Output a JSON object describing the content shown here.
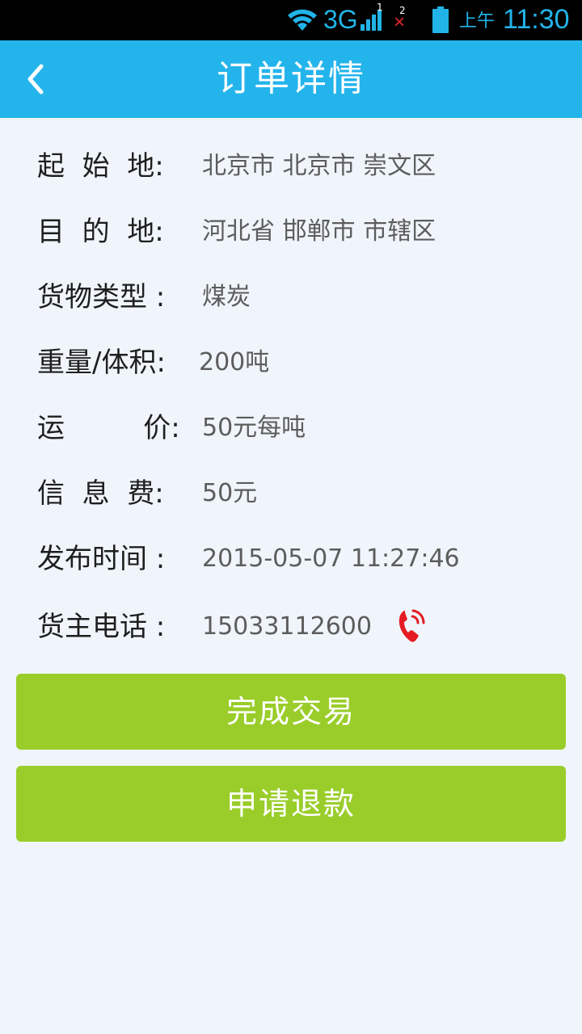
{
  "status_bar": {
    "network": "3G",
    "sim1": "1",
    "sim2": "2",
    "ampm": "上午",
    "time": "11:30",
    "accent_color": "#22b4e8",
    "nosim_color": "#e8262a"
  },
  "header": {
    "title": "订单详情",
    "back_icon": "chevron-left-icon",
    "background": "#24b4ec"
  },
  "details": [
    {
      "label": "起  始  地:",
      "value": "北京市 北京市 崇文区"
    },
    {
      "label": "目  的  地:",
      "value": "河北省 邯郸市 市辖区"
    },
    {
      "label": "货物类型 :",
      "value": "煤炭"
    },
    {
      "label": "重量/体积:",
      "value": "200吨"
    },
    {
      "label": "运         价:",
      "value": "50元每吨"
    },
    {
      "label": "信  息  费:",
      "value": "50元"
    },
    {
      "label": "发布时间 :",
      "value": "2015-05-07 11:27:46"
    },
    {
      "label": "货主电话 :",
      "value": "15033112600",
      "icon": "phone-icon"
    }
  ],
  "actions": {
    "complete_label": "完成交易",
    "refund_label": "申请退款",
    "button_color": "#9acd2a"
  }
}
